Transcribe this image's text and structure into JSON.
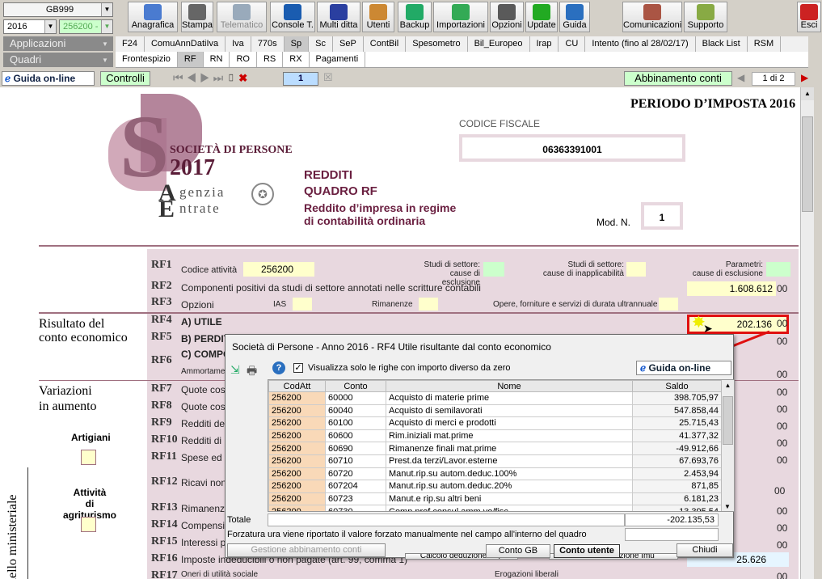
{
  "top": {
    "company": "GB999",
    "year": "2016",
    "code": "256200 -",
    "applicazioni": "Applicazioni",
    "quadri": "Quadri"
  },
  "toolbar": [
    "Anagrafica",
    "Stampa",
    "Telematico",
    "Console T.",
    "Multi ditta",
    "Utenti",
    "Backup",
    "Importazioni",
    "Opzioni",
    "Update",
    "Guida",
    "Comunicazioni",
    "Supporto",
    "Esci"
  ],
  "tabs1": [
    "F24",
    "ComuAnnDatiIva",
    "Iva",
    "770s",
    "Sp",
    "Sc",
    "SeP",
    "ContBil",
    "Spesometro",
    "Bil_Europeo",
    "Irap",
    "CU",
    "Intento (fino al 28/02/17)",
    "Black List",
    "RSM"
  ],
  "tabs2": [
    "Frontespizio",
    "RF",
    "RN",
    "RO",
    "RS",
    "RX",
    "Pagamenti"
  ],
  "navbar": {
    "guida": "Guida on-line",
    "controlli": "Controlli",
    "page": "1",
    "abbinamento": "Abbinamento conti",
    "pages": "1 di 2"
  },
  "doc": {
    "periodo": "PERIODO D’IMPOSTA 2016",
    "societa": "SOCIETÀ DI PERSONE",
    "anno": "2017",
    "agenzia": "genzia",
    "entrate": "ntrate",
    "cf_label": "CODICE FISCALE",
    "cf": "06363391001",
    "redditi": "REDDITI",
    "quadro": "QUADRO RF",
    "reddito1": "Reddito d’impresa in regime",
    "reddito2": "di contabilità ordinaria",
    "modn": "Mod. N.",
    "mod": "1",
    "risultato1": "Risultato del",
    "risultato2": "conto economico",
    "variazioni1": "Variazioni",
    "variazioni2": "in aumento",
    "artigiani": "Artigiani",
    "agri1": "Attività",
    "agri2": "di agriturismo",
    "ministeriale": "dello ministeriale",
    "rf1_txt": "Codice attività",
    "rf1_val": "256200",
    "studi1a": "Studi di settore:",
    "studi1b": "cause di esclusione",
    "studi2a": "Studi di settore:",
    "studi2b": "cause di inapplicabilità",
    "param1": "Parametri:",
    "param2": "cause di esclusione",
    "rf2_txt": "Componenti positivi da studi di settore annotati nelle scritture contabili",
    "rf2_val": "1.608.612",
    "rf3_txt": "Opzioni",
    "ias": "IAS",
    "rimanenze": "Rimanenze",
    "opere": "Opere, forniture e servizi di durata ultrannuale",
    "rf4_txt": "A) UTILE",
    "rf4_val": "202.136",
    "rf5_txt": "B) PERDITA",
    "rf6_txt": "C) COMPO",
    "rf6b": "Ammortame",
    "rf7": "Quote cost",
    "rf8": "Quote cost",
    "rf9": "Redditi dete",
    "rf10": "Redditi di i",
    "rf11": "Spese ed c",
    "rf12": "Ricavi non",
    "rf13": "Rimanenze",
    "rf14": "Compensi",
    "rf15": "Interessi pa",
    "rf16": "Imposte indeducibili o non pagate (art. 99, comma 1)",
    "rf16_val": "25.626",
    "rf17": "Oneri di utilità sociale",
    "erog": "Erogazioni liberali",
    "zero": "00"
  },
  "rows": [
    "RF1",
    "RF2",
    "RF3",
    "RF4",
    "RF5",
    "RF6",
    "RF7",
    "RF8",
    "RF9",
    "RF10",
    "RF11",
    "RF12",
    "RF13",
    "RF14",
    "RF15",
    "RF16",
    "RF17"
  ],
  "dialog": {
    "title": "Società di Persone - Anno 2016 - RF4 Utile risultante dal conto economico",
    "check": "Visualizza solo le righe con importo diverso da zero",
    "guida": "Guida on-line",
    "headers": [
      "CodAtt",
      "Conto",
      "Nome",
      "Saldo"
    ],
    "rows": [
      [
        "256200",
        "60000",
        "Acquisto di materie prime",
        "398.705,97"
      ],
      [
        "256200",
        "60040",
        "Acquisto di semilavorati",
        "547.858,44"
      ],
      [
        "256200",
        "60100",
        "Acquisto di merci e prodotti",
        "25.715,43"
      ],
      [
        "256200",
        "60600",
        "Rim.iniziali mat.prime",
        "41.377,32"
      ],
      [
        "256200",
        "60690",
        "Rimanenze finali mat.prime",
        "-49.912,66"
      ],
      [
        "256200",
        "60710",
        "Prest.da terzi/Lavor.esterne",
        "67.693,76"
      ],
      [
        "256200",
        "60720",
        "Manut.rip.su autom.deduc.100%",
        "2.453,94"
      ],
      [
        "256200",
        "607204",
        "Manut.rip.su autom.deduc.20%",
        "871,85"
      ],
      [
        "256200",
        "60723",
        "Manut.e rip.su altri beni",
        "6.181,23"
      ],
      [
        "256200",
        "60730",
        "Comp.prof.consul.amm.vo/fisc",
        "13.395,54"
      ]
    ],
    "totale": "Totale",
    "totale_val": "-202.135,53",
    "forzatura": "Forzatura",
    "forz_txt": "ura viene riportato il valore forzato manualmente nel campo all'interno del quadro",
    "gestione": "Gestione abbinamento conti",
    "contogb": "Conto GB",
    "contoutente": "Conto utente",
    "chiudi": "Chiudi",
    "calc1": "Calcolo deduzione Irap",
    "calc2": "Calcolo deduzione Imu"
  }
}
